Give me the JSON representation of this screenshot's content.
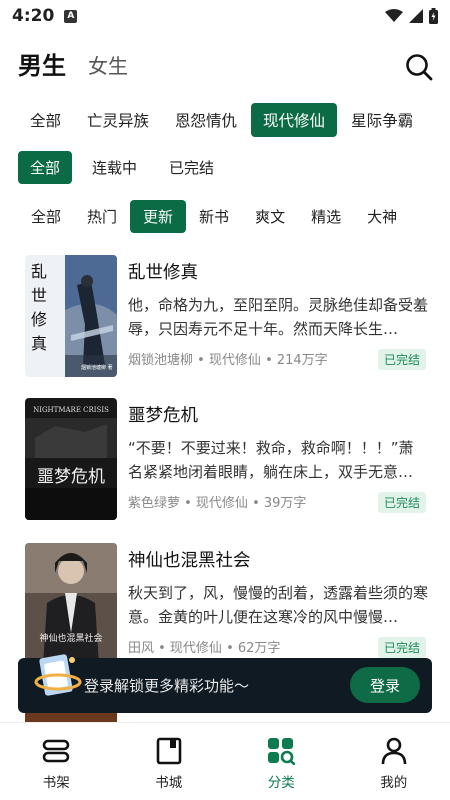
{
  "status": {
    "time": "4:20",
    "notif_letter": "A"
  },
  "gender_tabs": [
    {
      "label": "男生",
      "active": true
    },
    {
      "label": "女生",
      "active": false
    }
  ],
  "categories": [
    "全部",
    "亡灵异族",
    "恩怨情仇",
    "现代修仙",
    "星际争霸"
  ],
  "category_active_index": 3,
  "status_filters": [
    "全部",
    "连载中",
    "已完结"
  ],
  "status_active_index": 0,
  "sort_filters": [
    "全部",
    "热门",
    "更新",
    "新书",
    "爽文",
    "精选",
    "大神"
  ],
  "sort_active_index": 2,
  "books": [
    {
      "title": "乱世修真",
      "desc": "他，命格为九，至阳至阴。灵脉绝佳却备受羞辱，只因寿元不足十年。然而天降长生…",
      "meta": "烟锁池塘柳 • 现代修仙 • 214万字",
      "badge": "已完结",
      "cover_text": "乱世修真",
      "cover_author": "烟锁池塘柳 著"
    },
    {
      "title": "噩梦危机",
      "desc": "“不要！不要过来！救命，救命啊！！！”萧名紧紧地闭着眼睛，躺在床上，双手无意…",
      "meta": "紫色绿萝 • 现代修仙 • 39万字",
      "badge": "已完结",
      "cover_text": "噩梦危机",
      "cover_en": "NIGHTMARE CRISIS"
    },
    {
      "title": "神仙也混黑社会",
      "desc": "秋天到了，风，慢慢的刮着，透露着些须的寒意。金黄的叶儿便在这寒冷的风中慢慢…",
      "meta": "田风 • 现代修仙 • 62万字",
      "badge": "已完结",
      "cover_text": "神仙也混黑社会"
    }
  ],
  "login_banner": {
    "text": "登录解锁更多精彩功能～",
    "button": "登录"
  },
  "nav": [
    {
      "label": "书架",
      "icon": "bookshelf-icon",
      "active": false
    },
    {
      "label": "书城",
      "icon": "bookstore-icon",
      "active": false
    },
    {
      "label": "分类",
      "icon": "category-icon",
      "active": true
    },
    {
      "label": "我的",
      "icon": "profile-icon",
      "active": false
    }
  ],
  "colors": {
    "accent": "#0b6b45",
    "badge_bg": "#e2f3ea",
    "banner_bg": "#0f1a22"
  }
}
